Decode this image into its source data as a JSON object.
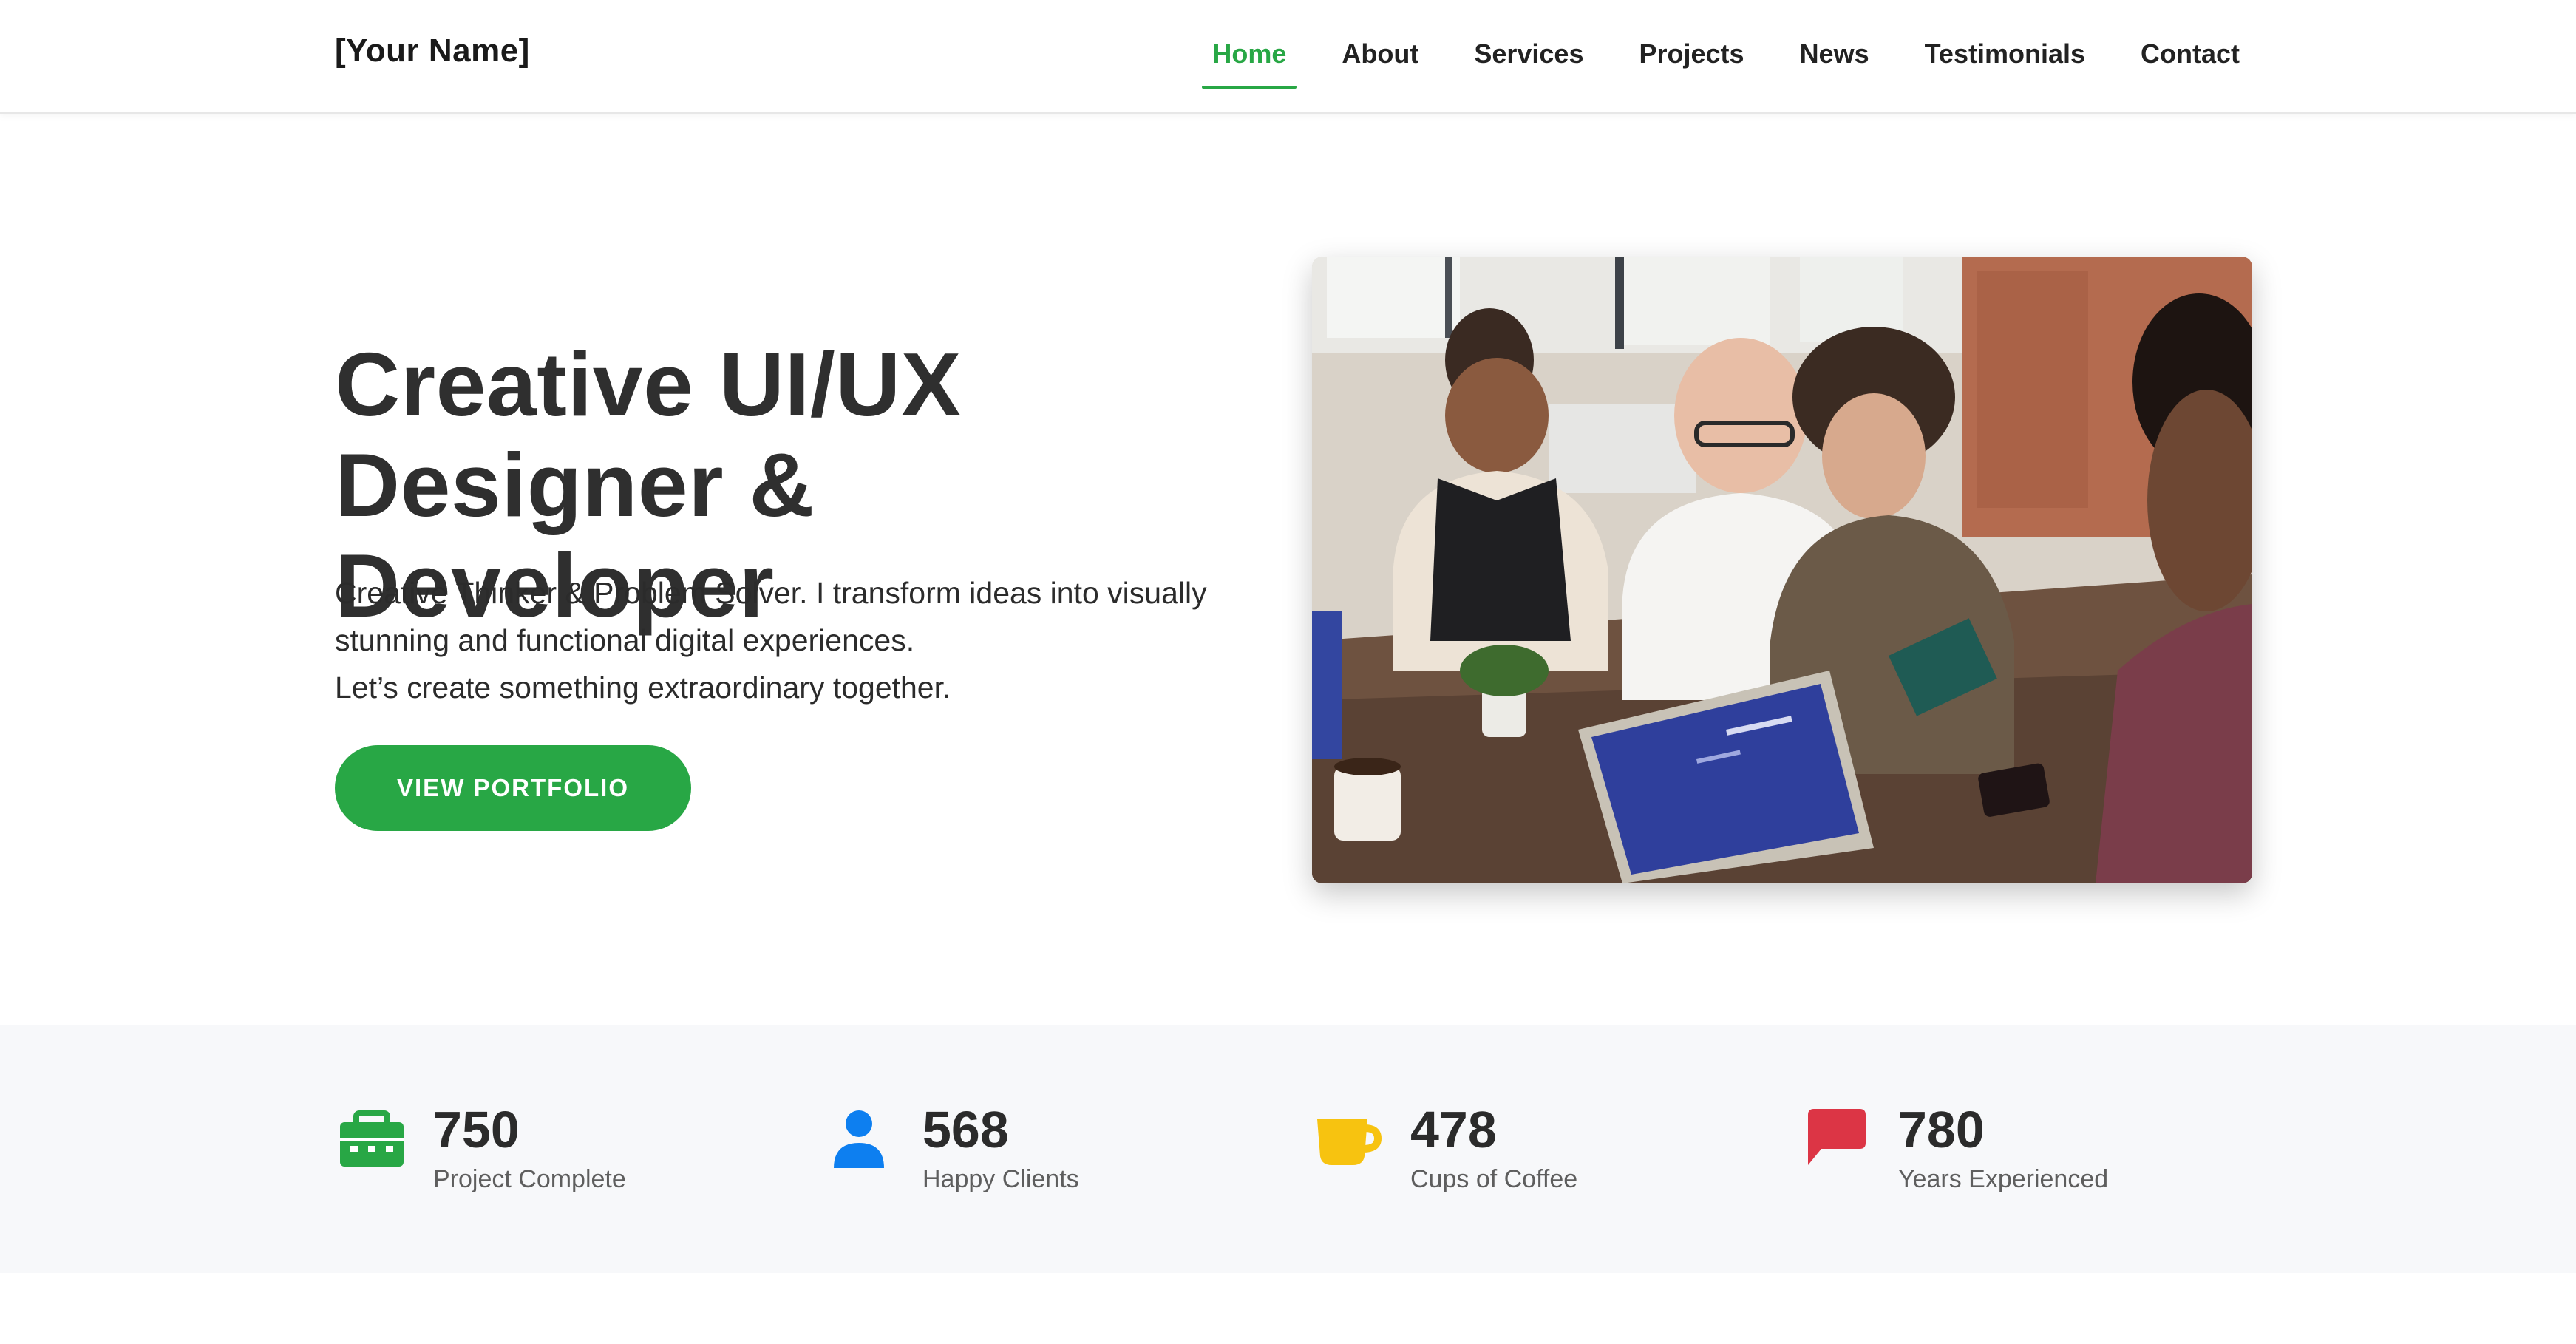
{
  "navbar": {
    "brand": "[Your Name]",
    "items": [
      {
        "label": "Home",
        "active": true
      },
      {
        "label": "About"
      },
      {
        "label": "Services"
      },
      {
        "label": "Projects"
      },
      {
        "label": "News"
      },
      {
        "label": "Testimonials"
      },
      {
        "label": "Contact"
      }
    ]
  },
  "hero": {
    "title_line1": "Creative UI/UX",
    "title_line2": "Designer & Developer",
    "text_line1": "Creative Thinker & Problem Solver. I transform ideas into visually",
    "text_line2": "stunning and functional digital experiences.",
    "text_line3": "Let’s create something extraordinary together.",
    "button_label": "VIEW PORTFOLIO",
    "image_icon": "team-meeting-photo"
  },
  "stats": [
    {
      "value": "750",
      "label": "Project Complete",
      "icon": "briefcase-icon",
      "color": "#28a745"
    },
    {
      "value": "568",
      "label": "Happy Clients",
      "icon": "user-icon",
      "color": "#0d7ff0"
    },
    {
      "value": "478",
      "label": "Cups of Coffee",
      "icon": "coffee-cup-icon",
      "color": "#f7c310"
    },
    {
      "value": "780",
      "label": "Years Experienced",
      "icon": "chat-bubble-icon",
      "color": "#dc3545"
    }
  ],
  "colors": {
    "accent": "#28a745",
    "text_dark": "#2f2f2f",
    "stats_background": "#f7f8fa"
  }
}
